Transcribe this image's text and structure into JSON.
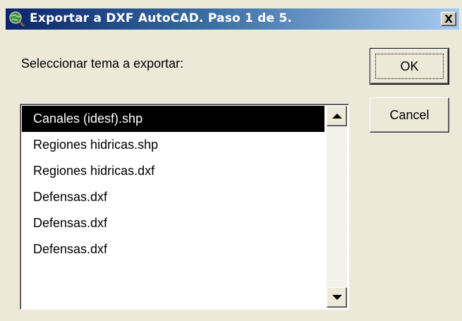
{
  "window": {
    "title": "Exportar a DXF AutoCAD. Paso 1 de 5.",
    "close_label": "X",
    "icon": "globe-magnifier-icon",
    "titlebar_color": "#0a246a"
  },
  "prompt": "Seleccionar tema a exportar:",
  "buttons": {
    "ok_label": "OK",
    "cancel_label": "Cancel"
  },
  "list": {
    "items": [
      "Canales (idesf).shp",
      "Regiones hidricas.shp",
      "Regiones hidricas.dxf",
      "Defensas.dxf",
      "Defensas.dxf",
      "Defensas.dxf"
    ],
    "selected_index": 0
  }
}
